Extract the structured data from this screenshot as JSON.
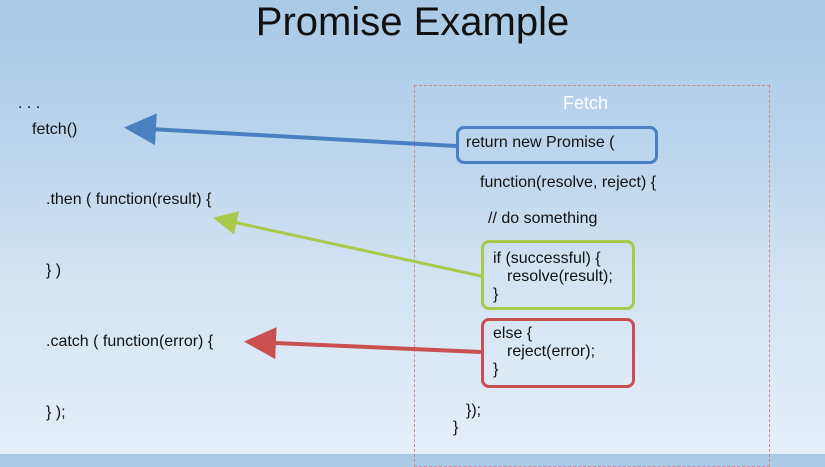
{
  "slide": {
    "title": "Promise Example",
    "left_code": {
      "ellipsis": ". . .",
      "fetch_call": "fetch()",
      "then_open": ".then ( function(result) {",
      "then_close": "} )",
      "catch_open": ".catch ( function(error) {",
      "catch_close": "} );"
    },
    "fetch_panel": {
      "label": "Fetch",
      "return_line": "return new Promise (",
      "function_line": "function(resolve, reject) {",
      "comment_line": "// do something",
      "if_line1": "if (successful) {",
      "if_line2": "resolve(result);",
      "if_line3": "}",
      "else_line1": "else {",
      "else_line2": "reject(error);",
      "else_line3": "}",
      "close_line1": "});",
      "close_line2": "}"
    },
    "colors": {
      "blue": "#4a7fc0",
      "green": "#a9c94a",
      "red": "#c85050",
      "frame": "#c98a8a"
    }
  }
}
